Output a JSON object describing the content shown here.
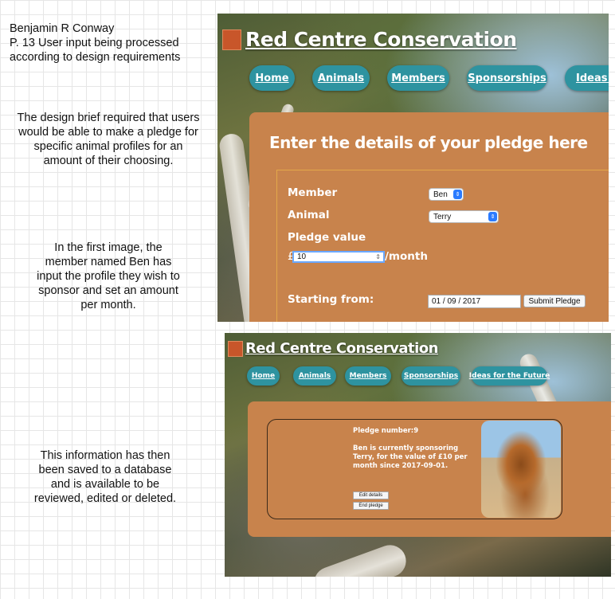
{
  "notes": {
    "intro": [
      "Benjamin R Conway",
      "P. 13 User input being processed",
      "according to design requirements"
    ],
    "brief": [
      "The design brief required that users",
      "would be able to make a pledge for",
      "specific animal profiles for an",
      "amount of their choosing."
    ],
    "first_image": [
      "In the first image, the",
      "member named Ben has",
      "input the profile they wish to",
      "sponsor and set an amount",
      "per month."
    ],
    "saved": [
      "This information has then",
      "been saved to a database",
      "and is available to be",
      "reviewed, edited or deleted."
    ]
  },
  "site": {
    "title": "Red Centre Conservation",
    "nav_top": [
      "Home",
      "Animals",
      "Members",
      "Sponsorships",
      "Ideas f"
    ],
    "nav_bottom": [
      "Home",
      "Animals",
      "Members",
      "Sponsorships",
      "Ideas for the Future"
    ]
  },
  "form": {
    "heading": "Enter the details of your pledge here",
    "member_label": "Member",
    "member_value": "Ben",
    "animal_label": "Animal",
    "animal_value": "Terry",
    "pledge_label": "Pledge value",
    "currency": "£",
    "pledge_value": "10",
    "per_month": "/month",
    "start_label": "Starting from:",
    "start_date": "01 / 09 / 2017",
    "submit_label": "Submit Pledge"
  },
  "pledge": {
    "number": "Pledge number:9",
    "summary": "Ben is currently sponsoring Terry, for the value of £10 per month since 2017-09-01.",
    "edit_label": "Edit details",
    "end_label": "End pledge"
  }
}
